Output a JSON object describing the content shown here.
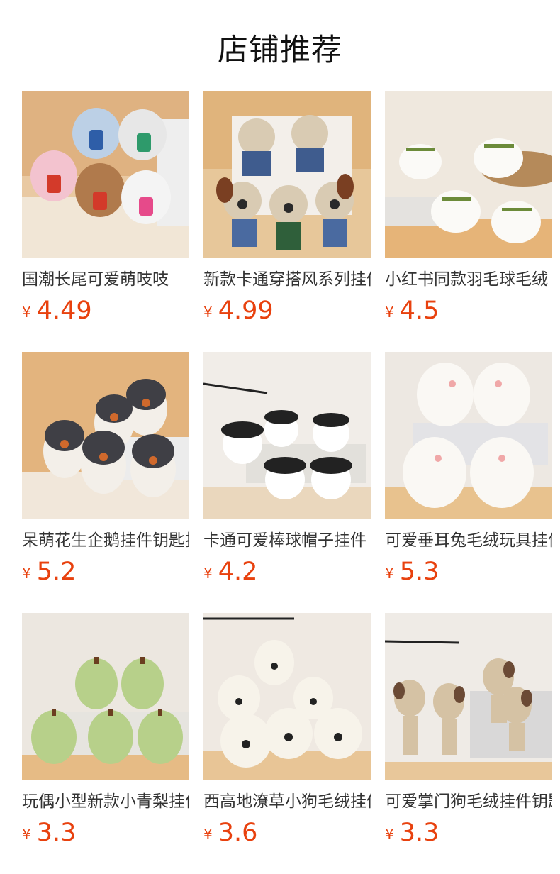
{
  "header": {
    "title": "店铺推荐"
  },
  "currency": "¥",
  "products": [
    {
      "name": "国潮长尾可爱萌吱吱",
      "price": "4.49",
      "image": "plush-cats-image",
      "bg": "#e9c9a2"
    },
    {
      "name": "新款卡通穿搭风系列挂件",
      "price": "4.99",
      "image": "plush-dogs-overalls-image",
      "bg": "#e7c79a"
    },
    {
      "name": "小红书同款羽毛球毛绒",
      "price": "4.5",
      "image": "plush-shuttlecock-image",
      "bg": "#efe8de"
    },
    {
      "name": "呆萌花生企鹅挂件钥匙扣",
      "price": "5.2",
      "image": "plush-penguins-image",
      "bg": "#e3b47e"
    },
    {
      "name": "卡通可爱棒球帽子挂件",
      "price": "4.2",
      "image": "plush-baseballs-image",
      "bg": "#f1ede8"
    },
    {
      "name": "可爱垂耳兔毛绒玩具挂件",
      "price": "5.3",
      "image": "plush-bunnies-image",
      "bg": "#ede8e2"
    },
    {
      "name": "玩偶小型新款小青梨挂件",
      "price": "3.3",
      "image": "plush-pears-image",
      "bg": "#ece7e0"
    },
    {
      "name": "西高地潦草小狗毛绒挂件",
      "price": "3.6",
      "image": "plush-westies-image",
      "bg": "#efe9e2"
    },
    {
      "name": "可爱掌门狗毛绒挂件钥匙",
      "price": "3.3",
      "image": "plush-gromit-image",
      "bg": "#efebe6"
    }
  ]
}
